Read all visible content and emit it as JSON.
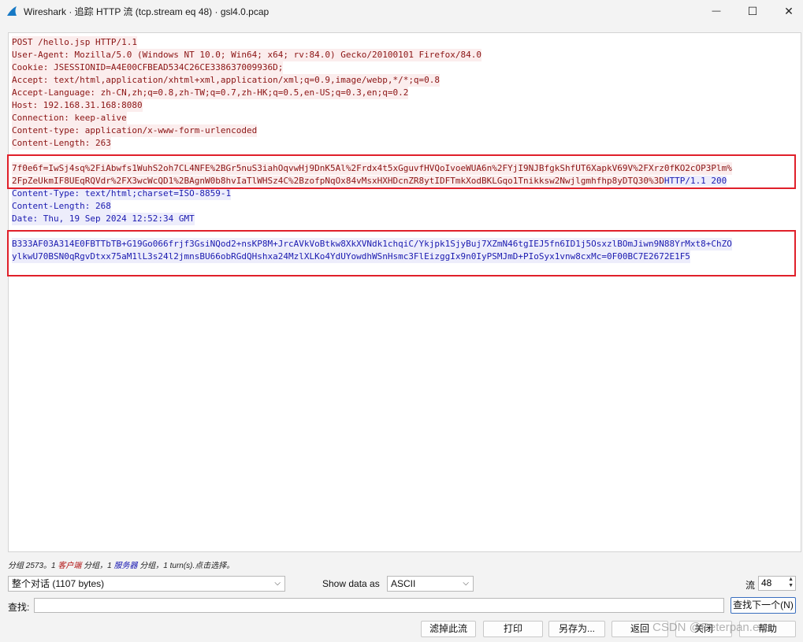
{
  "window": {
    "title": "Wireshark · 追踪 HTTP 流 (tcp.stream eq 48) · gsl4.0.pcap",
    "minimize": "—",
    "maximize": "☐",
    "close": "✕",
    "icon": "wireshark-fin-icon"
  },
  "stream": {
    "request_headers": [
      "POST /hello.jsp HTTP/1.1",
      "User-Agent: Mozilla/5.0 (Windows NT 10.0; Win64; x64; rv:84.0) Gecko/20100101 Firefox/84.0",
      "Cookie: JSESSIONID=A4E00CFBEAD534C26CE338637009936D;",
      "Accept: text/html,application/xhtml+xml,application/xml;q=0.9,image/webp,*/*;q=0.8",
      "Accept-Language: zh-CN,zh;q=0.8,zh-TW;q=0.7,zh-HK;q=0.5,en-US;q=0.3,en;q=0.2",
      "Host: 192.168.31.168:8080",
      "Connection: keep-alive",
      "Content-type: application/x-www-form-urlencoded",
      "Content-Length: 263"
    ],
    "request_body_1": "7f0e6f=IwSj4sq%2FiAbwfs1WuhS2oh7CL4NFE%2BGr5nuS3iahOqvwHj9DnK5Al%2Frdx4t5xGguvfHVQoIvoeWUA6n%2FYjI9NJBfgkShfUT6XapkV69V%2FXrz0fKO2cOP3Plm%",
    "request_body_2": "2FpZeUkmIF8UEqRQVdr%2FX3wcWcQD1%2BAgnW0b8hvIaTlWHSz4C%2BzofpNqOx84vMsxHXHDcnZR8ytIDFTmkXodBKLGqo1Tnikksw2Nwjlgmhfhp8yDTQ30%3D",
    "response_status_tail": "HTTP/1.1 200",
    "response_headers": [
      "Content-Type: text/html;charset=ISO-8859-1",
      "Content-Length: 268",
      "Date: Thu, 19 Sep 2024 12:52:34 GMT"
    ],
    "response_body_1": "B333AF03A314E0FBTTbTB+G19Go066frjf3GsiNQod2+nsKP8M+JrcAVkVoBtkw8XkXVNdk1chqiC/Ykjpk1SjyBuj7XZmN46tgIEJ5fn6ID1j5OsxzlBOmJiwn9N88YrMxt8+ChZO",
    "response_body_2": "ylkwU70BSN0qRgvDtxx75aM1lL3s24l2jmnsBU66obRGdQHshxa24MzlXLKo4YdUYowdhWSnHsmc3FlEizggIx9n0IyPSMJmD+PIoSyx1vnw8cxMc=0F00BC7E2672E1F5"
  },
  "status": {
    "prefix": "分组 2573。1 ",
    "client": "客户端",
    "mid": " 分组，1 ",
    "server": "服务器",
    "suffix": " 分组，1 turn(s).点击选择。"
  },
  "controls": {
    "conversation_select": "整个对话 (1107 bytes)",
    "show_data_as_label": "Show data as",
    "show_data_as_value": "ASCII",
    "stream_label": "流",
    "stream_value": "48",
    "find_label": "查找:",
    "find_placeholder": "",
    "find_next_button": "查找下一个(N)",
    "filter_out_button": "滤掉此流",
    "print_button": "打印",
    "save_as_button": "另存为...",
    "back_button": "返回",
    "close_button": "关闭",
    "help_button": "帮助"
  },
  "watermark": "CSDN @Peterpan.exe",
  "colors": {
    "client_text": "#8b1414",
    "client_bg": "#fbeded",
    "server_text": "#1a1ab0",
    "server_bg": "#ededfb",
    "highlight_box": "#e0202a"
  }
}
